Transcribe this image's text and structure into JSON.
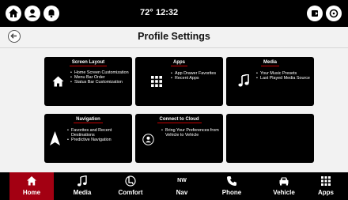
{
  "status": {
    "temperature": "72°",
    "time": "12:32"
  },
  "header": {
    "title": "Profile Settings"
  },
  "tiles": [
    {
      "title": "Screen Layout",
      "icon": "home-icon",
      "items": [
        "Home Screen Customization",
        "Menu Bar Order",
        "Status Bar Customization"
      ]
    },
    {
      "title": "Apps",
      "icon": "grid-icon",
      "items": [
        "App Drawer Favorites",
        "Recent Apps"
      ]
    },
    {
      "title": "Media",
      "icon": "music-note-icon",
      "items": [
        "Your Music Presets",
        "Last Played Media Source"
      ]
    },
    {
      "title": "Navigation",
      "icon": "navigation-arrow-icon",
      "items": [
        "Favorites and Recent Destinations",
        "Predictive Navigation"
      ]
    },
    {
      "title": "Connect to Cloud",
      "icon": "profile-cloud-icon",
      "items": [
        "Bring Your Preferences from Vehicle to Vehicle"
      ]
    },
    {
      "title": "",
      "icon": "",
      "items": []
    }
  ],
  "nav": {
    "items": [
      {
        "label": "Home",
        "icon": "home-icon",
        "active": true
      },
      {
        "label": "Media",
        "icon": "music-note-icon",
        "active": false
      },
      {
        "label": "Comfort",
        "icon": "seat-climate-icon",
        "active": false
      },
      {
        "label": "Nav",
        "icon": "compass-icon",
        "compass": "NW",
        "active": false
      },
      {
        "label": "Phone",
        "icon": "phone-icon",
        "active": false
      },
      {
        "label": "Vehicle",
        "icon": "vehicle-icon",
        "active": false
      },
      {
        "label": "Apps",
        "icon": "grid-icon",
        "active": false
      }
    ]
  },
  "colors": {
    "accent": "#a30012",
    "tile_bg": "#000000",
    "page_bg": "#f2f2f2"
  }
}
